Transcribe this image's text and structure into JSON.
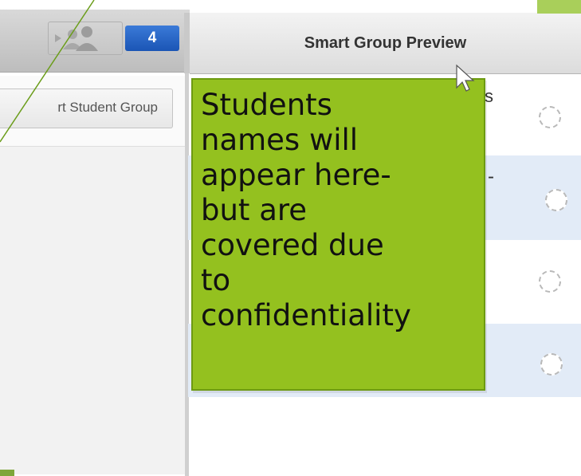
{
  "toolbar": {
    "group_count": "4"
  },
  "left_panel": {
    "student_group_button_label": "rt Student Group"
  },
  "preview": {
    "title": "Smart Group Preview",
    "peek_text": [
      "s",
      "-"
    ]
  },
  "annotation": {
    "note_text": "Students\nnames will\nappear here-\nbut are\ncovered due\nto\nconfidentiality"
  },
  "colors": {
    "note_fill": "#94c11f",
    "badge": "#1b55b5",
    "alt_row": "#e2ebf7"
  },
  "icons": [
    "play-arrow-icon",
    "user-group-icon",
    "pointer-cursor-icon",
    "empty-circle-icon"
  ]
}
